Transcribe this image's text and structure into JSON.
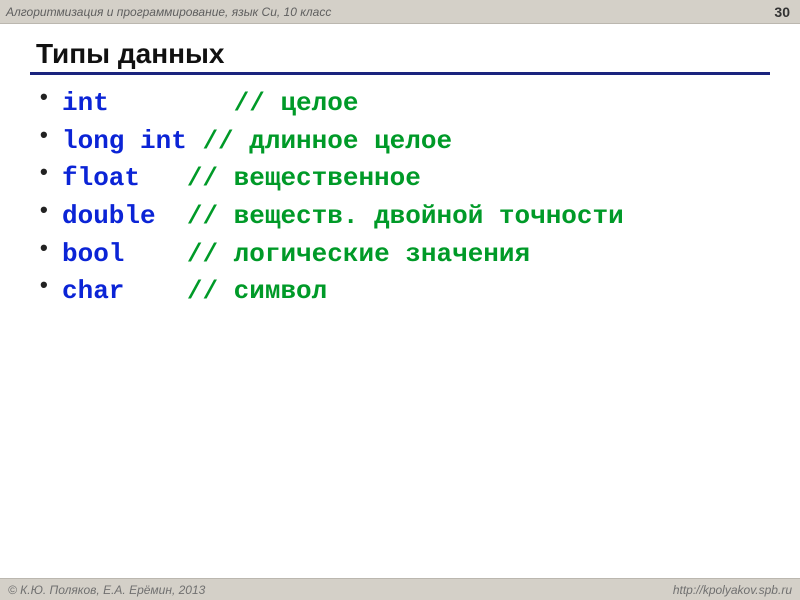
{
  "header": {
    "title": "Алгоритмизация и программирование, язык Си, 10 класс",
    "page_number": "30"
  },
  "heading": "Типы данных",
  "types": [
    {
      "keyword": "int",
      "pad": "        ",
      "comment": "// целое"
    },
    {
      "keyword": "long int",
      "pad": " ",
      "comment": "// длинное целое"
    },
    {
      "keyword": "float",
      "pad": "   ",
      "comment": "// вещественное"
    },
    {
      "keyword": "double",
      "pad": "  ",
      "comment": "// веществ. двойной точности"
    },
    {
      "keyword": "bool",
      "pad": "    ",
      "comment": "// логические значения"
    },
    {
      "keyword": "char",
      "pad": "    ",
      "comment": "// символ"
    }
  ],
  "footer": {
    "copyright": "© К.Ю. Поляков, Е.А. Ерёмин, 2013",
    "url": "http://kpolyakov.spb.ru"
  }
}
